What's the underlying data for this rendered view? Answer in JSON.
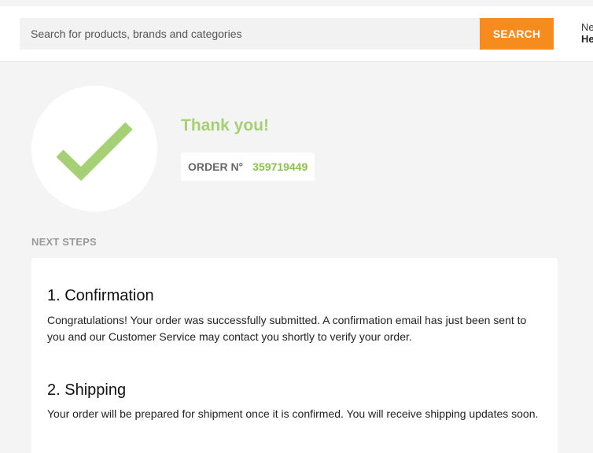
{
  "header": {
    "search_placeholder": "Search for products, brands and categories",
    "search_button": "SEARCH",
    "account_line1": "Ne",
    "account_line2": "He"
  },
  "confirmation": {
    "thanks": "Thank you!",
    "order_label": "ORDER N°",
    "order_number": "359719449",
    "check_icon": "checkmark-icon",
    "check_color": "#a6d076"
  },
  "next_steps": {
    "heading": "NEXT STEPS",
    "steps": [
      {
        "title": "1. Confirmation",
        "text": "Congratulations! Your order was successfully submitted. A confirmation email has just been sent to you and our Customer Service may contact you shortly to verify your order."
      },
      {
        "title": "2. Shipping",
        "text": "Your order will be prepared for shipment once it is confirmed. You will receive shipping updates soon."
      }
    ]
  },
  "colors": {
    "accent": "#f68b1e",
    "success": "#a6d076",
    "background": "#f4f4f4"
  }
}
